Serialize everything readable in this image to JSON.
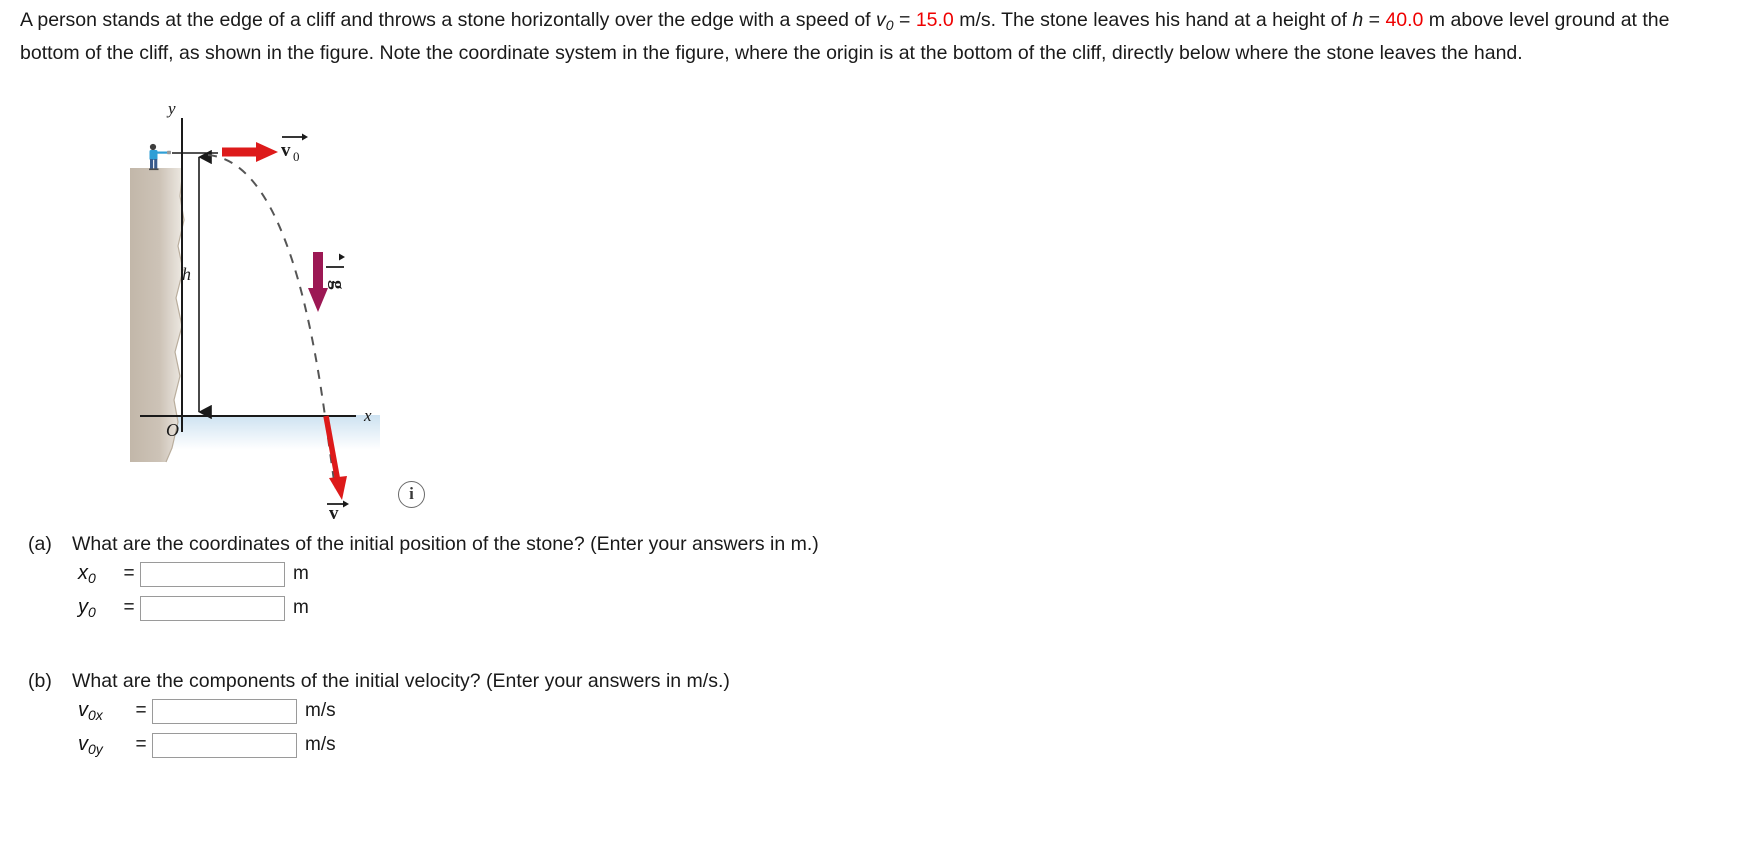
{
  "problem": {
    "line1_part1": "A person stands at the edge of a cliff and throws a stone horizontally over the edge with a speed of ",
    "v0_symbol": "v",
    "v0_sub": "0",
    "eq1": " = ",
    "v0_value": "15.0",
    "unit_speed": " m/s. ",
    "line1_part2": "The stone leaves his hand at a height of ",
    "h_symbol": "h",
    "eq2": " = ",
    "h_value": "40.0",
    "unit_length": " m ",
    "line2": "above level ground at the bottom of the cliff, as shown in the figure. Note the coordinate system in the figure, where the origin is at the bottom of the cliff, directly below where the stone leaves the hand."
  },
  "figure": {
    "axis_y_label": "y",
    "axis_x_label": "x",
    "origin_label": "O",
    "height_label": "h",
    "v0_vector_label": "v",
    "v0_vector_sub": "0",
    "g_vector_label": "g",
    "v_vector_label": "v",
    "info_icon_label": "i",
    "colors": {
      "cliff": "#c9bfb2",
      "water": "#d9e9f4",
      "v_arrow_red": "#e01b1b",
      "g_arrow_purple": "#9c1854",
      "axis_black": "#1a1a1a",
      "trajectory_dash": "#555555",
      "person_shirt": "#2e9ed6",
      "person_pants": "#3a5b8c"
    }
  },
  "parts": [
    {
      "label": "(a)",
      "question": "What are the coordinates of the initial position of the stone? (Enter your answers in m.)",
      "fields": [
        {
          "symbol": "x",
          "sub": "0",
          "equals": "=",
          "value": "",
          "unit": "m"
        },
        {
          "symbol": "y",
          "sub": "0",
          "equals": "=",
          "value": "",
          "unit": "m"
        }
      ]
    },
    {
      "label": "(b)",
      "question": "What are the components of the initial velocity? (Enter your answers in m/s.)",
      "fields": [
        {
          "symbol": "v",
          "sub": "0x",
          "equals": "=",
          "value": "",
          "unit": "m/s"
        },
        {
          "symbol": "v",
          "sub": "0y",
          "equals": "=",
          "value": "",
          "unit": "m/s"
        }
      ]
    }
  ]
}
